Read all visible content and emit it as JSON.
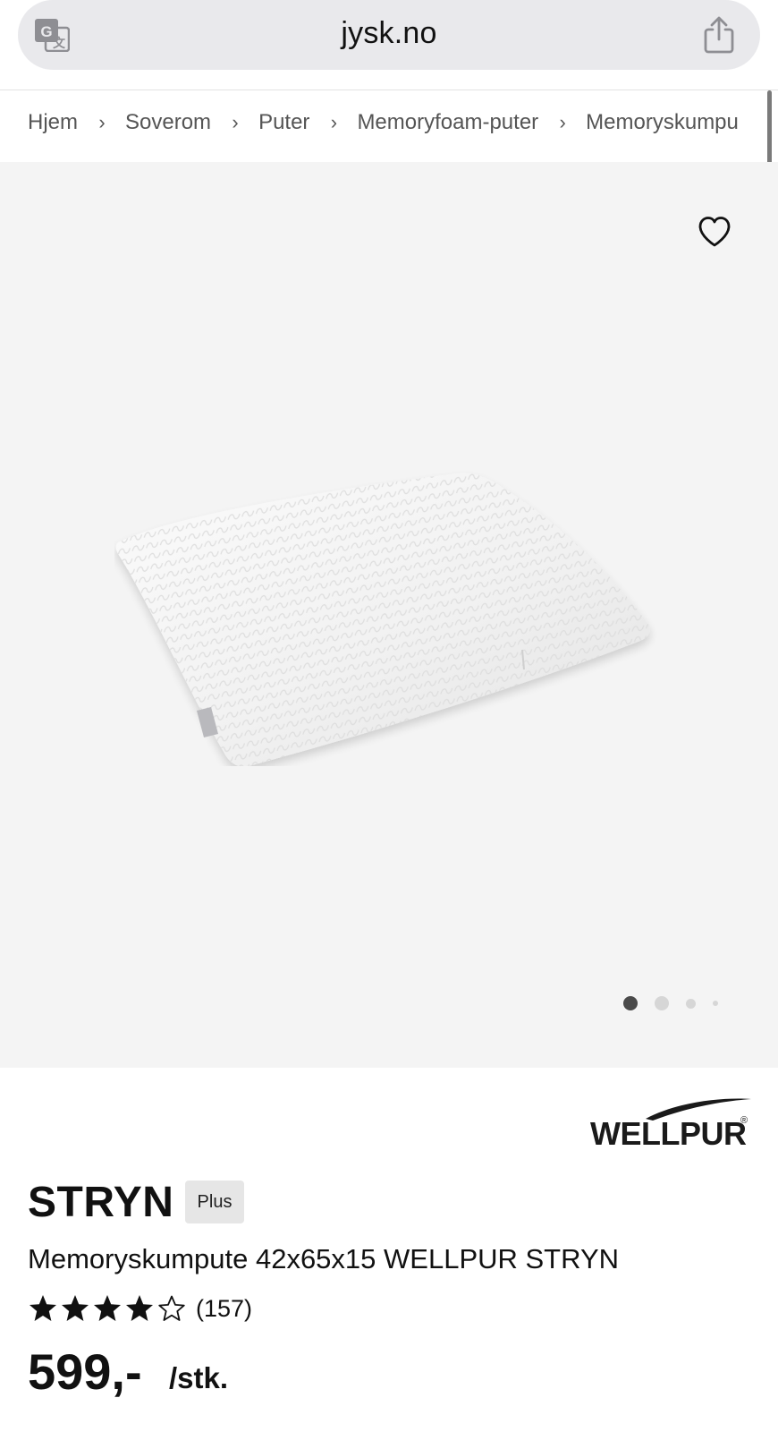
{
  "browser": {
    "url": "jysk.no",
    "icons": {
      "translate": "translate-icon",
      "share": "share-icon"
    }
  },
  "breadcrumb": {
    "items": [
      "Hjem",
      "Soverom",
      "Puter",
      "Memoryfoam-puter",
      "Memoryskumpu"
    ],
    "separator": "›"
  },
  "gallery": {
    "favorite_icon": "heart-icon",
    "image_count": 4,
    "active_index": 0
  },
  "brand": {
    "name": "WELLPUR",
    "registered": "®"
  },
  "product": {
    "title": "STRYN",
    "badge": "Plus",
    "subtitle": "Memoryskumpute 42x65x15 WELLPUR STRYN",
    "rating_stars": 4,
    "rating_max": 5,
    "rating_count": "(157)",
    "price": "599,-",
    "unit": "/stk."
  },
  "colors": {
    "gallery_bg": "#f4f4f4",
    "urlbar_bg": "#e9e9ec",
    "badge_bg": "#e6e6e6",
    "text": "#111111"
  }
}
